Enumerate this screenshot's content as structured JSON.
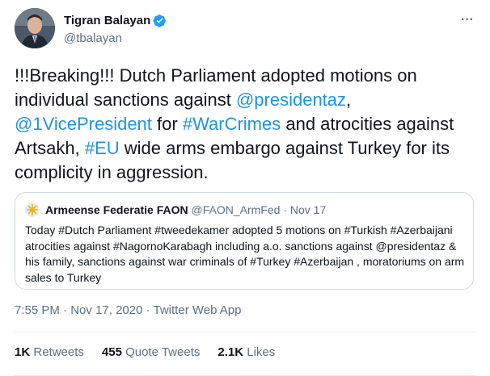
{
  "author": {
    "display_name": "Tigran Balayan",
    "handle": "@tbalayan",
    "verified": true
  },
  "more_icon": "···",
  "tweet": {
    "segments": [
      {
        "text": "!!!Breaking!!! Dutch Parliament adopted motions on individual sanctions against ",
        "link": false
      },
      {
        "text": "@presidentaz",
        "link": true
      },
      {
        "text": ", ",
        "link": false
      },
      {
        "text": "@1VicePresident",
        "link": true
      },
      {
        "text": " for ",
        "link": false
      },
      {
        "text": "#WarCrimes",
        "link": true
      },
      {
        "text": " and atrocities against Artsakh, ",
        "link": false
      },
      {
        "text": "#EU",
        "link": true
      },
      {
        "text": " wide arms embargo against Turkey for its complicity in aggression.",
        "link": false
      }
    ]
  },
  "quote": {
    "name": "Armeense Federatie FAON",
    "handle": "@FAON_ArmFed",
    "separator": " · ",
    "date": "Nov 17",
    "text": "Today #Dutch Parliament #tweedekamer adopted 5 motions on #Turkish #Azerbaijani atrocities against #NagornoKarabagh including a.o. sanctions against @presidentaz & his family, sanctions against war criminals of #Turkey #Azerbaijan , moratoriums on arm sales to Turkey"
  },
  "meta": {
    "time": "7:55 PM",
    "separator": " · ",
    "date": "Nov 17, 2020",
    "source": "Twitter Web App"
  },
  "stats": {
    "retweets_count": "1K",
    "retweets_label": "Retweets",
    "quotes_count": "455",
    "quotes_label": "Quote Tweets",
    "likes_count": "2.1K",
    "likes_label": "Likes"
  },
  "colors": {
    "link": "#1b95e0",
    "secondary_text": "#5b7083",
    "verified": "#1da1f2"
  }
}
